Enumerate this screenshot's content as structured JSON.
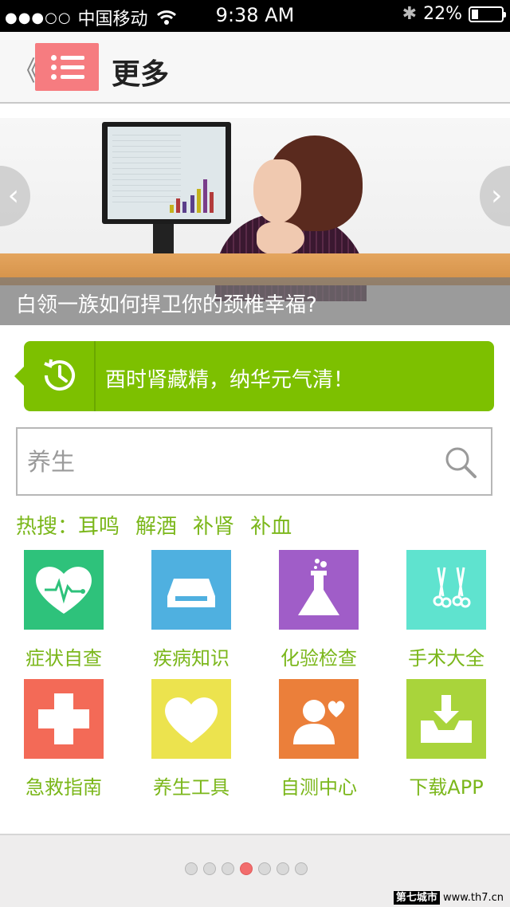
{
  "status_bar": {
    "signal_dots": "●●●○○",
    "carrier": "中国移动",
    "wifi_icon": "wifi-icon",
    "time": "9:38 AM",
    "bluetooth_icon": "bluetooth-icon",
    "battery": "22%"
  },
  "nav": {
    "back": "《",
    "title": "更多",
    "menu_color": "#f67c80"
  },
  "banner": {
    "caption": "白领一族如何捍卫你的颈椎幸福?",
    "prev": "‹",
    "next": "›"
  },
  "tip": {
    "text": "酉时肾藏精，纳华元气清！",
    "color": "#7dc000"
  },
  "search": {
    "placeholder": "养生"
  },
  "hot": {
    "label": "热搜：",
    "keywords": [
      "耳鸣",
      "解酒",
      "补肾",
      "补血"
    ]
  },
  "tiles": [
    {
      "label": "症状自查",
      "color": "#2ec27b",
      "icon": "heart-pulse-icon"
    },
    {
      "label": "疾病知识",
      "color": "#4fb0e0",
      "icon": "drive-icon"
    },
    {
      "label": "化验检查",
      "color": "#a05dc8",
      "icon": "flask-icon"
    },
    {
      "label": "手术大全",
      "color": "#5fe3cf",
      "icon": "surgical-scissors-icon"
    },
    {
      "label": "急救指南",
      "color": "#f36a57",
      "icon": "medical-cross-icon"
    },
    {
      "label": "养生工具",
      "color": "#ece34e",
      "icon": "heart-icon"
    },
    {
      "label": "自测中心",
      "color": "#eb7f3a",
      "icon": "user-heart-icon"
    },
    {
      "label": "下载APP",
      "color": "#a9d43b",
      "icon": "download-tray-icon"
    }
  ],
  "pager": {
    "count": 7,
    "active": 4
  },
  "watermark": {
    "a": "第七城市",
    "b": "www.th7.cn"
  }
}
